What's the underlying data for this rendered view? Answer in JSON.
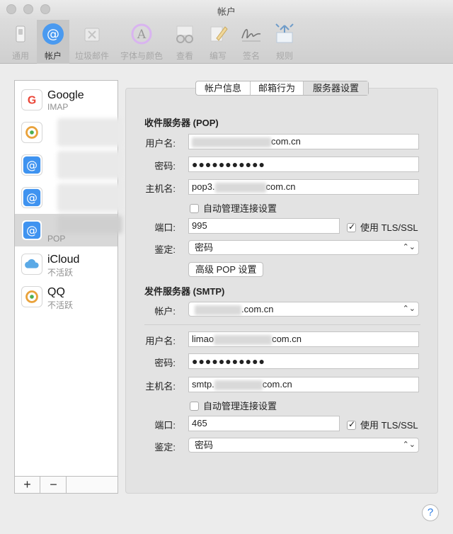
{
  "window": {
    "title": "帐户"
  },
  "toolbar": {
    "items": [
      {
        "label": "通用",
        "icon": "switch-icon"
      },
      {
        "label": "帐户",
        "icon": "at-icon",
        "active": true
      },
      {
        "label": "垃圾邮件",
        "icon": "trash-icon"
      },
      {
        "label": "字体与颜色",
        "icon": "font-color-icon"
      },
      {
        "label": "查看",
        "icon": "glasses-icon"
      },
      {
        "label": "编写",
        "icon": "pencil-icon"
      },
      {
        "label": "签名",
        "icon": "signature-icon"
      },
      {
        "label": "规则",
        "icon": "rules-icon"
      }
    ]
  },
  "accounts": [
    {
      "name": "Google",
      "sub": "IMAP",
      "icon": "google-icon"
    },
    {
      "name": "",
      "sub": "",
      "icon": "qq-mail-icon"
    },
    {
      "name": "",
      "sub": "",
      "icon": "mail-at-icon"
    },
    {
      "name": "",
      "sub": "",
      "icon": "mail-at-icon"
    },
    {
      "name": "",
      "sub": "POP",
      "icon": "mail-at-icon",
      "selected": true
    },
    {
      "name": "iCloud",
      "sub": "不活跃",
      "icon": "icloud-icon"
    },
    {
      "name": "QQ",
      "sub": "不活跃",
      "icon": "qq-mail-icon"
    }
  ],
  "sidebar_footer": {
    "add": "+",
    "remove": "−"
  },
  "tabs": [
    {
      "label": "帐户信息"
    },
    {
      "label": "邮箱行为"
    },
    {
      "label": "服务器设置",
      "active": true
    }
  ],
  "incoming": {
    "title": "收件服务器 (POP)",
    "username_label": "用户名:",
    "username_suffix": "com.cn",
    "password_label": "密码:",
    "password_mask": "●●●●●●●●●●●",
    "host_label": "主机名:",
    "host_prefix": "pop3.",
    "host_suffix": "com.cn",
    "auto_manage": "自动管理连接设置",
    "auto_manage_checked": false,
    "port_label": "端口:",
    "port_value": "995",
    "tls_label": "使用 TLS/SSL",
    "tls_checked": true,
    "auth_label": "鉴定:",
    "auth_value": "密码",
    "advanced_button": "高级 POP 设置"
  },
  "outgoing": {
    "title": "发件服务器 (SMTP)",
    "account_label": "帐户:",
    "account_suffix": ".com.cn",
    "username_label": "用户名:",
    "username_prefix": "limao",
    "username_suffix": "com.cn",
    "password_label": "密码:",
    "password_mask": "●●●●●●●●●●●",
    "host_label": "主机名:",
    "host_prefix": "smtp.",
    "host_suffix": "com.cn",
    "auto_manage": "自动管理连接设置",
    "auto_manage_checked": false,
    "port_label": "端口:",
    "port_value": "465",
    "tls_label": "使用 TLS/SSL",
    "tls_checked": true,
    "auth_label": "鉴定:",
    "auth_value": "密码"
  },
  "help": {
    "label": "?"
  },
  "colors": {
    "accent": "#2a7be4",
    "google_red": "#ea4335",
    "icloud_blue": "#5aa9e6"
  }
}
